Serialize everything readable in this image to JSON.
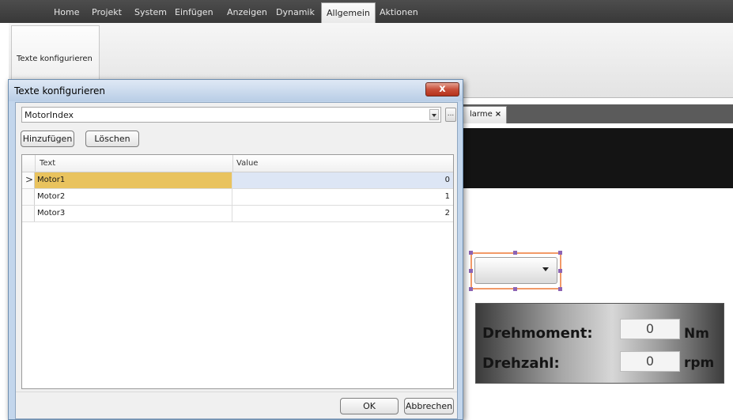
{
  "menubar": {
    "items": [
      "Home",
      "Projekt",
      "System",
      "Einfügen",
      "Anzeigen",
      "Dynamik",
      "Allgemein",
      "Aktionen"
    ],
    "active_index": 6
  },
  "ribbon": {
    "group_label": "Texte konfigurieren"
  },
  "document_tab": {
    "label": "larme",
    "close": "×"
  },
  "dialog": {
    "title": "Texte konfigurieren",
    "close": "x",
    "combo_value": "MotorIndex",
    "ellipsis": "...",
    "add_button": "Hinzufügen",
    "delete_button": "Löschen",
    "columns": [
      "Text",
      "Value"
    ],
    "current_row_marker": ">",
    "rows": [
      {
        "text": "Motor1",
        "value": "0"
      },
      {
        "text": "Motor2",
        "value": "1"
      },
      {
        "text": "Motor3",
        "value": "2"
      }
    ],
    "selected_row": 0,
    "ok_button": "OK",
    "cancel_button": "Abbrechen"
  },
  "panel": {
    "torque_label": "Drehmoment:",
    "torque_value": "0",
    "torque_unit": "Nm",
    "speed_label": "Drehzahl:",
    "speed_value": "0",
    "speed_unit": "rpm"
  },
  "colors": {
    "selection_cell": "#e9c35e",
    "selection_value": "#dde6f5",
    "close_button": "#c84f3a",
    "selection_frame": "#f29a68",
    "handles": "#8c64b4"
  }
}
